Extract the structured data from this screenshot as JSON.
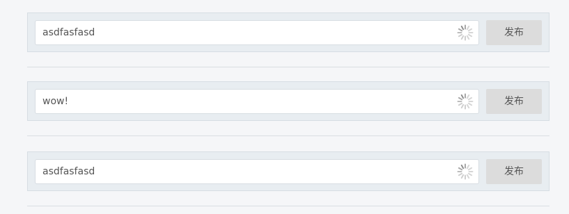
{
  "posts": [
    {
      "input_value": "asdfasfasd",
      "loading_icon": "loading-spinner-icon",
      "button_label": "发布"
    },
    {
      "input_value": "wow!",
      "loading_icon": "loading-spinner-icon",
      "button_label": "发布"
    },
    {
      "input_value": "asdfasfasd",
      "loading_icon": "loading-spinner-icon",
      "button_label": "发布"
    }
  ],
  "colors": {
    "background": "#f5f6f8",
    "row_background": "#e8edf1",
    "input_background": "#ffffff",
    "button_background": "#dcdcdc",
    "text": "#555555",
    "spinner": "#bbbbbb"
  }
}
